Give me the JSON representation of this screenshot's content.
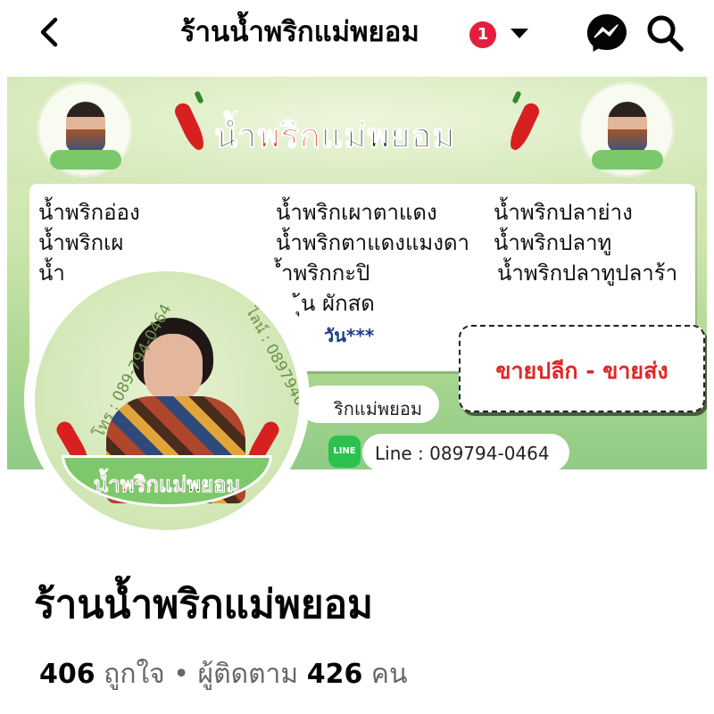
{
  "topbar": {
    "title": "ร้านน้ำพริกแม่พยอม",
    "notification_count": "1",
    "icons": {
      "back": "back-chevron-icon",
      "dropdown": "caret-down-icon",
      "messenger": "messenger-icon",
      "search": "search-icon"
    }
  },
  "cover": {
    "brand": {
      "prefix": "น้ำ",
      "red": "พริก",
      "suffix": "แม่พยอม"
    },
    "menu": [
      "น้ำพริกอ่อง",
      "น้ำพริกเผาตาแดง",
      "น้ำพริกปลาย่าง",
      "น้ำพริกเผ",
      "น้ำพริกตาแดงแมงดา",
      "น้ำพริกปลาทู",
      "น้ำ",
      "้ำพริกกะปิ",
      "น้ำพริกปลาทูปลาร้า",
      "ุ้น ผักสด"
    ],
    "note": "วัน***",
    "retail_label": "ขายปลีก - ขายส่ง",
    "fb_pill": "ริกแม่พยอม",
    "line_badge": "LINE",
    "line_contact": "Line : 089794-0464"
  },
  "profile": {
    "phone_text": "โทร : 089-794-0464",
    "line_text": "ไลน์ : 0897940464",
    "banner": {
      "prefix": "น้ำ",
      "red": "พริก",
      "suffix": "แม่พยอม"
    }
  },
  "page": {
    "name": "ร้านน้ำพริกแม่พยอม",
    "likes_count": "406",
    "likes_label": "ถูกใจ",
    "separator": "•",
    "followers_label": "ผู้ติดตาม",
    "followers_count": "426",
    "followers_unit": "คน"
  },
  "colors": {
    "brand_red": "#e42221",
    "badge_red": "#e41e3f",
    "line_green": "#2ac14e",
    "cover_green": "#cfe6ad"
  }
}
